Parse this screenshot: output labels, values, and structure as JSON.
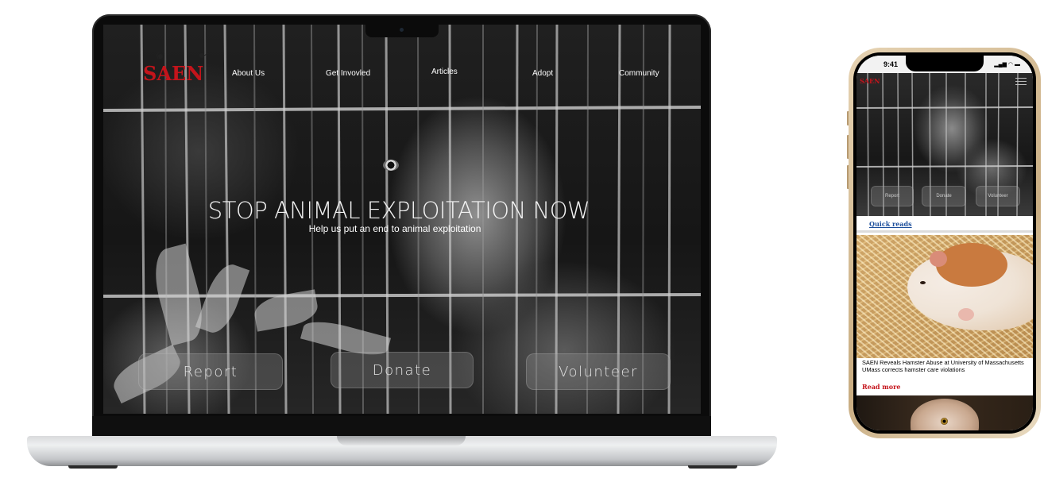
{
  "desktop": {
    "logo": "SAEN",
    "nav": {
      "about": "About Us",
      "involved": "Get Invovled",
      "articles": "Articles",
      "adopt": "Adopt",
      "community": "Community"
    },
    "hero": {
      "title": "STOP ANIMAL EXPLOITATION NOW",
      "subtitle": "Help us put an end to animal exploitation"
    },
    "buttons": {
      "report": "Report",
      "donate": "Donate",
      "volunteer": "Volunteer"
    }
  },
  "mobile": {
    "status_time": "9:41",
    "logo": "SAEN",
    "buttons": {
      "report": "Report",
      "donate": "Donate",
      "volunteer": "Volunteer"
    },
    "quick_reads_label": "Quick reads",
    "article": {
      "headline": "SAEN Reveals Hamster Abuse at University of Massachusetts",
      "summary": "UMass corrects hamster care violations",
      "read_more": "Read more"
    }
  },
  "colors": {
    "brand_red": "#c4141b",
    "link_blue": "#1d4f9c",
    "phone_gold": "#c9ad82"
  }
}
